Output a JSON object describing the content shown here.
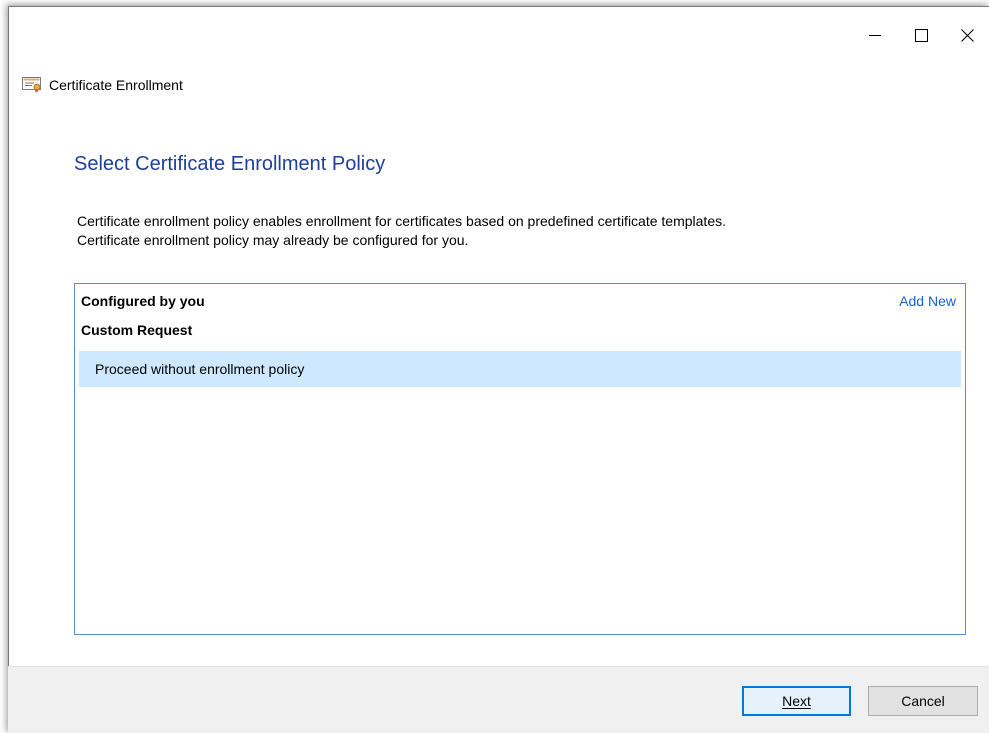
{
  "window": {
    "controls": {
      "minimize_icon": "minimize-icon",
      "maximize_icon": "maximize-icon",
      "close_icon": "close-icon"
    }
  },
  "app": {
    "title": "Certificate Enrollment",
    "icon": "certificate-icon"
  },
  "page": {
    "heading": "Select Certificate Enrollment Policy",
    "description_line1": "Certificate enrollment policy enables enrollment for certificates based on predefined certificate templates.",
    "description_line2": "Certificate enrollment policy may already be configured for you."
  },
  "policy_list": {
    "group_label": "Configured by you",
    "add_new_label": "Add New",
    "sub_group_label": "Custom Request",
    "items": [
      {
        "label": "Proceed without enrollment policy",
        "selected": true
      }
    ]
  },
  "footer": {
    "next_label": "Next",
    "cancel_label": "Cancel"
  },
  "colors": {
    "heading": "#1e3f9a",
    "link": "#1a63c9",
    "selection": "#cde8ff",
    "box_border": "#5b8ec7",
    "default_button_border": "#0078d7"
  }
}
